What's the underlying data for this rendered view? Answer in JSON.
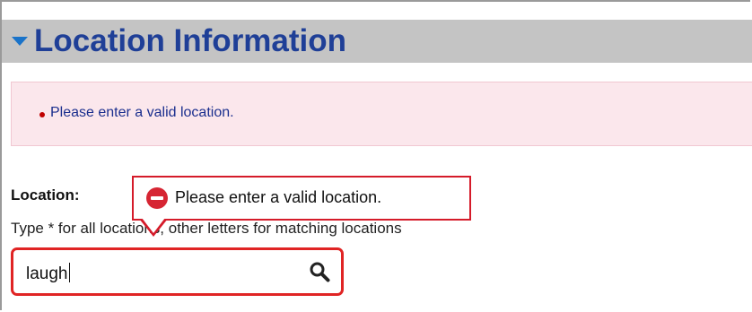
{
  "section": {
    "title": "Location Information"
  },
  "error_panel": {
    "messages": [
      "Please enter a valid location."
    ]
  },
  "form": {
    "location_label": "Location:",
    "help_text": "Type * for all locations, other letters for matching locations",
    "location_value": "laugh"
  },
  "tooltip": {
    "text": "Please enter a valid location.",
    "icon": "stop-error-icon"
  },
  "icons": {
    "collapse": "triangle-down-icon",
    "search": "search-icon"
  },
  "colors": {
    "title": "#1f3f97",
    "header_bg": "#c4c4c4",
    "error_panel_bg": "#fbe7ec",
    "error_text": "#1b2f8e",
    "error_border": "#e02424"
  }
}
